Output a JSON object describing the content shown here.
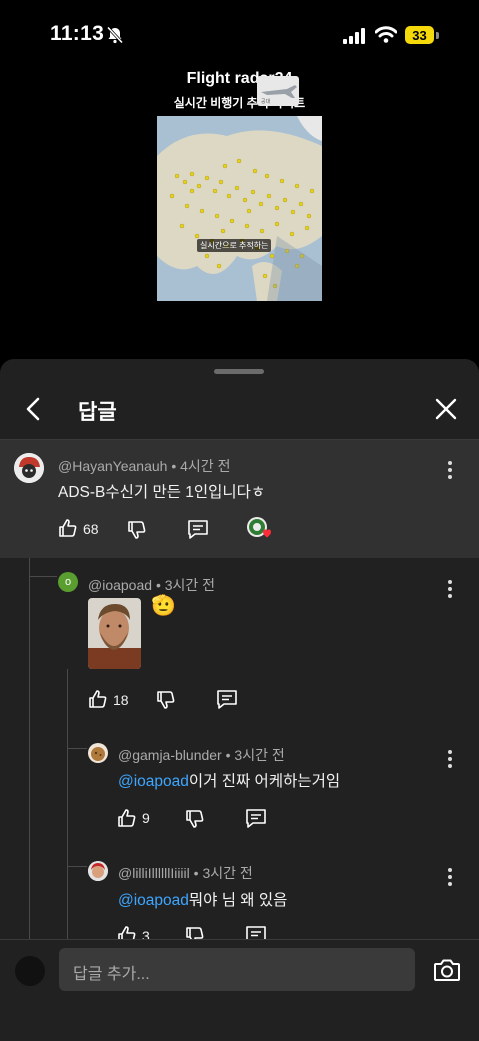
{
  "status_bar": {
    "time": "11:13",
    "battery": "33"
  },
  "video": {
    "title": "Flight radar24",
    "subtitle": "실시간 비행기 추적 사이트",
    "map_caption": "실시간으로 추적하는"
  },
  "sheet": {
    "title": "답글",
    "back_icon": "chevron-left-icon",
    "close_icon": "close-icon"
  },
  "comments": [
    {
      "user": "@HayanYeanauh",
      "time": "4시간 전",
      "text": "ADS-B수신기 만든 1인입니다ㅎ",
      "likes": "68"
    },
    {
      "user": "@ioapoad",
      "time": "3시간 전",
      "avatar_letter": "o",
      "emoji": "🫡",
      "likes": "18"
    },
    {
      "user": "@gamja-blunder",
      "time": "3시간 전",
      "mention": "@ioapoad",
      "text": "이거 진짜 어케하는거임",
      "likes": "9"
    },
    {
      "user": "@lilliIllllllIiiiil",
      "time": "3시간 전",
      "mention": "@ioapoad",
      "text": "뭐야 님 왜 있음",
      "likes": "3"
    }
  ],
  "compose": {
    "placeholder": "답글 추가...",
    "camera_icon": "camera-icon"
  }
}
